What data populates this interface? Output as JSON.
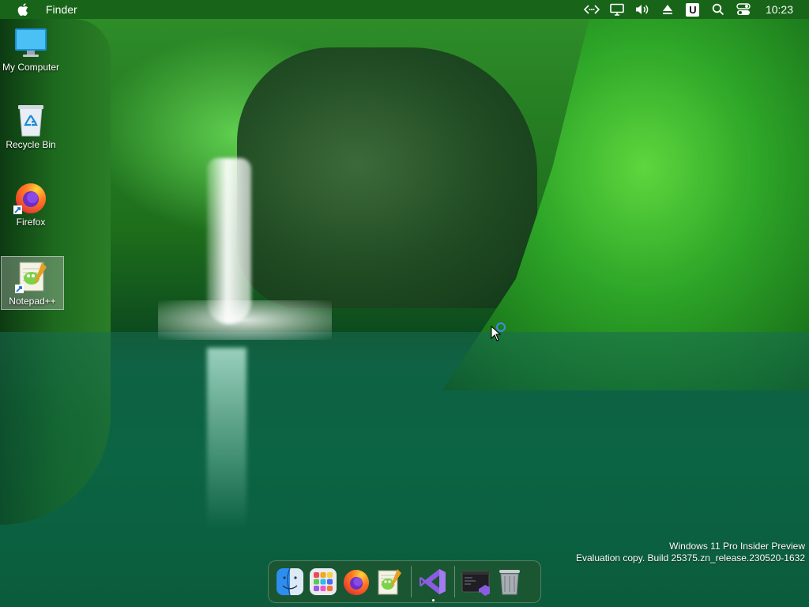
{
  "menubar": {
    "app_name": "Finder",
    "clock": "10:23",
    "tray_icons": [
      "code-icon",
      "display-icon",
      "volume-icon",
      "eject-icon",
      "u-badge-icon",
      "search-icon",
      "control-center-icon"
    ],
    "u_badge_text": "U",
    "background": "#125a14"
  },
  "desktop": {
    "icons": [
      {
        "label": "My Computer",
        "icon": "monitor-icon"
      },
      {
        "label": "Recycle Bin",
        "icon": "recycle-bin-icon"
      },
      {
        "label": "Firefox",
        "icon": "firefox-icon"
      },
      {
        "label": "Notepad++",
        "icon": "notepadpp-icon"
      }
    ]
  },
  "watermark": {
    "line1": "Windows 11 Pro Insider Preview",
    "line2": "Evaluation copy. Build 25375.zn_release.230520-1632"
  },
  "dock": {
    "items": [
      "finder-icon",
      "launchpad-icon",
      "firefox-icon",
      "notepadpp-icon",
      "visual-studio-icon",
      "vs-terminal-icon",
      "trash-icon"
    ]
  }
}
